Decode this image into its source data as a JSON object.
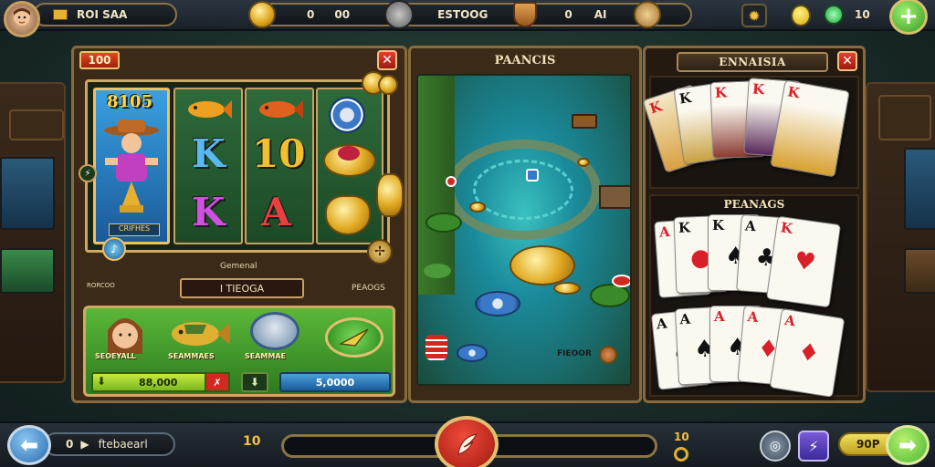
{
  "topbar": {
    "player_name": "ROI SAA",
    "left_coin_value": "0",
    "left_counter": "00",
    "center_score": "ESTOOG",
    "right_counter_a": "0",
    "right_counter_b": "AI",
    "gems_count": "10"
  },
  "slot_panel": {
    "badge": "100",
    "jackpot_label": "8105",
    "portrait_caption": "CRIFHES",
    "subtitle": "Gemenal",
    "reel_symbols": [
      "K",
      "K",
      "10",
      "A"
    ],
    "bet_field": "I TIEOGA",
    "right_label": "PEAOGS",
    "left_caption": "RORCOO",
    "char_labels": [
      "SEOEYALL",
      "SEAMMAES",
      "SEAMMAE"
    ],
    "balance_value": "88,000",
    "win_value": "5,0000"
  },
  "game_panel": {
    "title": "PAANCIS",
    "chip_caption": "FIEOOR"
  },
  "cards_top": {
    "title": "ENNAISIA"
  },
  "cards_bottom": {
    "title": "PEANAGS"
  },
  "bottombar": {
    "page_number": "0",
    "nav_label": "ftebaearl",
    "left_digit": "10",
    "right_digit": "10",
    "play_label": "90P"
  },
  "colors": {
    "accent_gold": "#e0a820",
    "panel_wood": "#3c2a18",
    "felt_green": "#2e6a3a",
    "button_green": "#4ab830",
    "button_blue": "#3a78c8"
  },
  "icons": [
    "menu-icon",
    "coin-icon",
    "mask-icon",
    "shield-icon",
    "eye-icon",
    "settings-icon",
    "drop-icon",
    "gem-icon",
    "plus-icon",
    "close-icon",
    "back-arrow-icon",
    "next-arrow-icon",
    "lightning-icon",
    "bell-icon",
    "play-icon"
  ]
}
